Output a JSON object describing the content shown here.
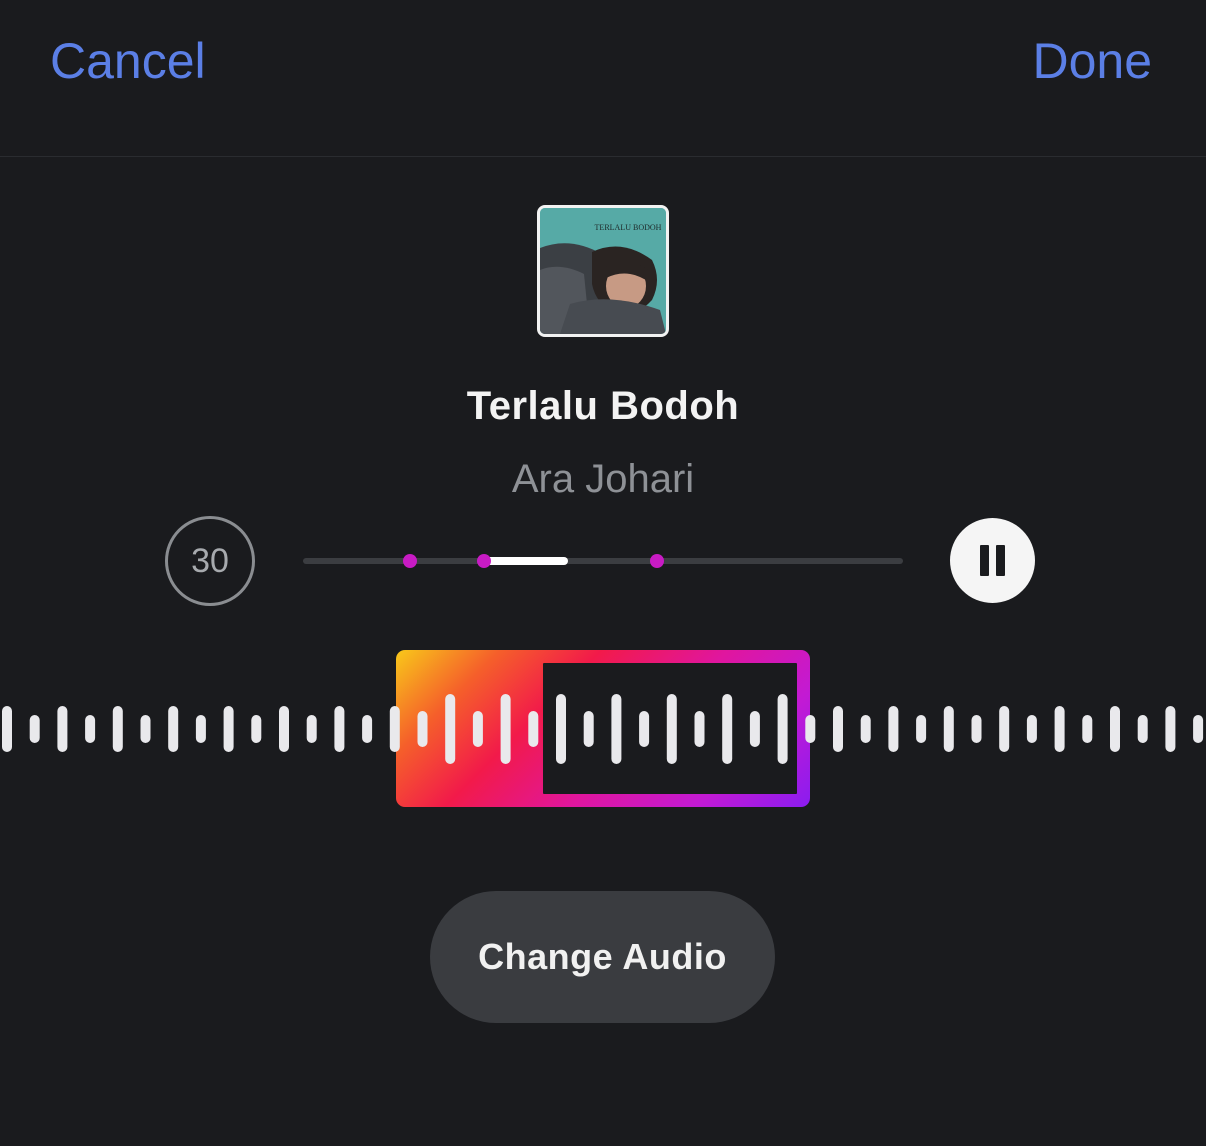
{
  "header": {
    "cancel_label": "Cancel",
    "done_label": "Done"
  },
  "song": {
    "title": "Terlalu Bodoh",
    "artist": "Ara Johari",
    "album_art_text": "TERLALU BODOH"
  },
  "player": {
    "timer_label": "30",
    "pause_icon": "pause-icon"
  },
  "actions": {
    "change_audio_label": "Change Audio"
  },
  "colors": {
    "accent": "#5b7fe6",
    "marker": "#c81bc4",
    "background": "#1a1b1e"
  }
}
